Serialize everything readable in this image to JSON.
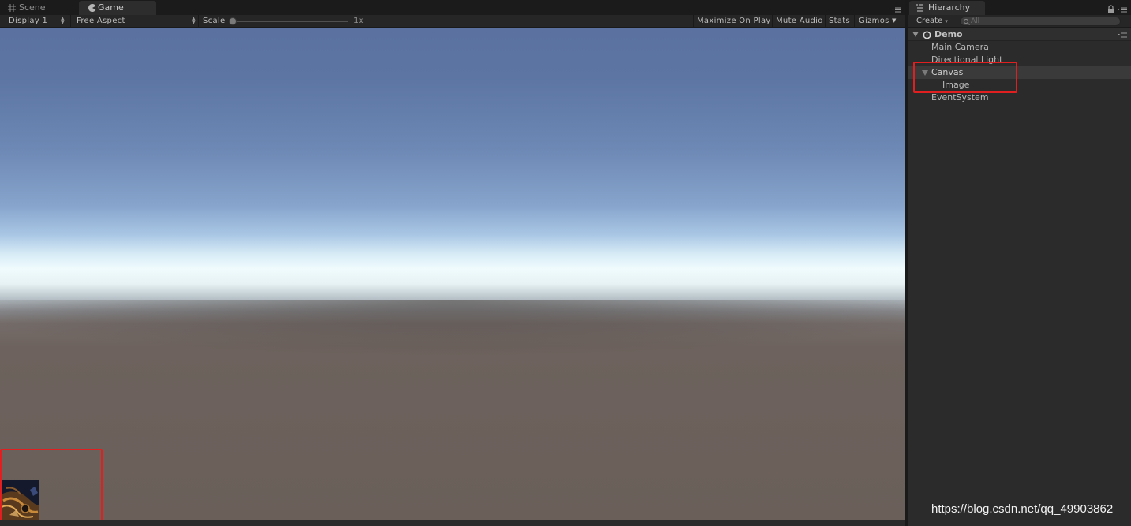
{
  "colors": {
    "accent_highlight": "#e02020",
    "editor_bg": "#2b2b2b",
    "sky_top": "#5b72a0",
    "horizon": "#f0fbfd",
    "ground": "#6a5f59"
  },
  "game_panel": {
    "tabs": [
      {
        "label": "Scene",
        "icon": "grid-icon",
        "active": false
      },
      {
        "label": "Game",
        "icon": "pacman-icon",
        "active": true
      }
    ],
    "toolbar": {
      "display": "Display 1",
      "aspect": "Free Aspect",
      "scale_label": "Scale",
      "scale_value": "1x",
      "scale_level": 0.0,
      "maximize_on_play": "Maximize On Play",
      "mute_audio": "Mute Audio",
      "stats": "Stats",
      "gizmos": "Gizmos"
    }
  },
  "hierarchy": {
    "tab_label": "Hierarchy",
    "create_label": "Create",
    "search_placeholder": "All",
    "scene_name": "Demo",
    "items": [
      {
        "label": "Main Camera",
        "depth": 1
      },
      {
        "label": "Directional Light",
        "depth": 1
      },
      {
        "label": "Canvas",
        "depth": 1,
        "expanded": true
      },
      {
        "label": "Image",
        "depth": 2
      },
      {
        "label": "EventSystem",
        "depth": 1
      }
    ]
  },
  "watermark": "https://blog.csdn.net/qq_49903862"
}
